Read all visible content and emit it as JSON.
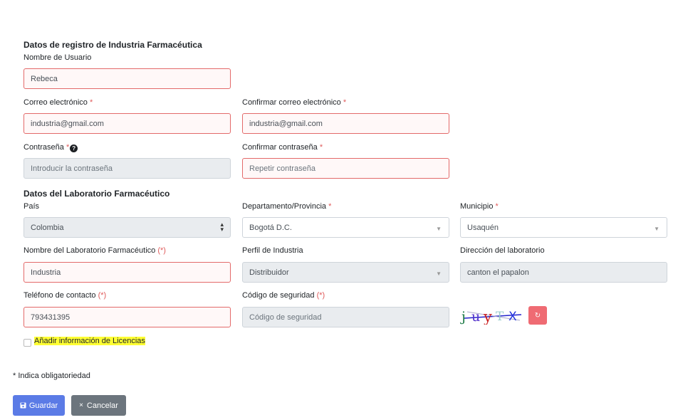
{
  "registro": {
    "title": "Datos de registro de Industria Farmacéutica",
    "usuario_label": "Nombre de Usuario",
    "usuario_value": "Rebeca",
    "correo_label": "Correo electrónico",
    "correo_value": "industria@gmail.com",
    "confirmar_correo_label": "Confirmar correo electrónico",
    "confirmar_correo_value": "industria@gmail.com",
    "contrasena_label": "Contraseña",
    "contrasena_placeholder": "Introducir la contraseña",
    "confirmar_contrasena_label": "Confirmar contraseña",
    "confirmar_contrasena_placeholder": "Repetir contraseña",
    "asterisk": "*"
  },
  "laboratorio": {
    "title": "Datos del Laboratorio Farmacéutico",
    "pais_label": "País",
    "pais_value": "Colombia",
    "departamento_label": "Departamento/Provincia",
    "departamento_value": "Bogotá D.C.",
    "municipio_label": "Municipio",
    "municipio_value": "Usaquén",
    "nombre_lab_label": "Nombre del Laboratorio Farmacéutico",
    "nombre_lab_value": "Industria",
    "perfil_label": "Perfil de Industria",
    "perfil_value": "Distribuidor",
    "direccion_label": "Dirección del laboratorio",
    "direccion_value": "canton el papalon",
    "telefono_label": "Teléfono de contacto",
    "telefono_value": "793431395",
    "codigo_label": "Código de seguridad",
    "codigo_placeholder": "Código de seguridad",
    "required_mark": "(*)",
    "captcha_text": "juyTX"
  },
  "licencias_label": "Añadir información de Licencias",
  "nota_obligatoriedad": "* Indica obligatoriedad",
  "buttons": {
    "guardar": "Guardar",
    "cancelar": "Cancelar"
  },
  "icons": {
    "save": "floppy-disk-icon",
    "cancel": "close-icon",
    "refresh": "refresh-icon",
    "help": "question-circle-icon"
  },
  "colors": {
    "error_border": "#e36a6a",
    "primary": "#5b7be6",
    "secondary": "#6c757d",
    "danger": "#ef6b73",
    "highlight": "#ffff33"
  }
}
